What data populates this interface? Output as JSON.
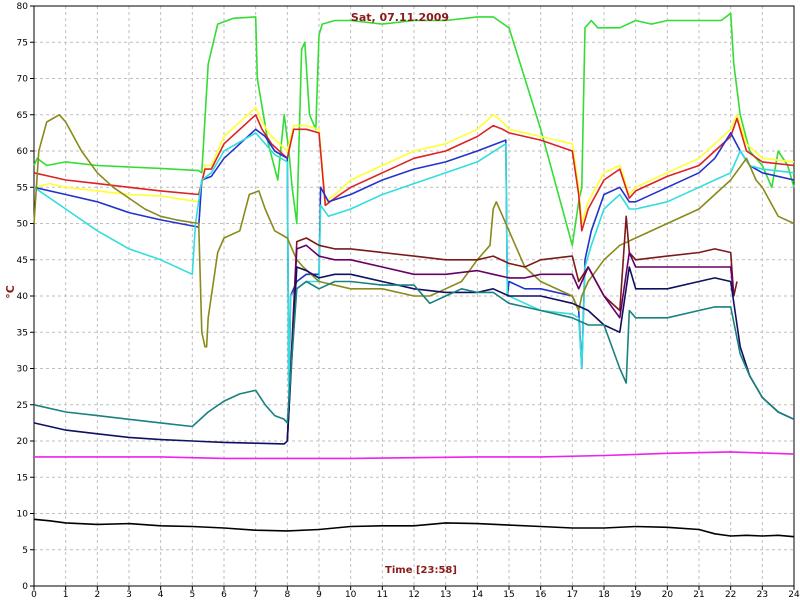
{
  "chart_data": {
    "type": "line",
    "title": "Sat, 07.11.2009",
    "xlabel": "Time [23:58]",
    "ylabel": "°C",
    "xlim": [
      0,
      24
    ],
    "ylim": [
      0,
      80
    ],
    "xticks": [
      0,
      1,
      2,
      3,
      4,
      5,
      6,
      7,
      8,
      9,
      10,
      11,
      12,
      13,
      14,
      15,
      16,
      17,
      18,
      19,
      20,
      21,
      22,
      23,
      24
    ],
    "yticks": [
      0,
      5,
      10,
      15,
      20,
      25,
      30,
      35,
      40,
      45,
      50,
      55,
      60,
      65,
      70,
      75,
      80
    ],
    "grid": true,
    "series": [
      {
        "color": "#33dd33",
        "x": [
          0,
          0.1,
          0.4,
          1,
          2,
          3,
          4,
          5.2,
          5.3,
          5.5,
          5.8,
          6.3,
          7,
          7.05,
          7.4,
          7.7,
          7.9,
          8.05,
          8.15,
          8.3,
          8.45,
          8.55,
          8.7,
          8.9,
          9.0,
          9.1,
          9.5,
          10,
          11,
          12,
          13,
          14,
          14.5,
          15,
          16,
          16.5,
          17,
          17.2,
          17.3,
          17.4,
          17.6,
          17.8,
          18.5,
          19,
          19.5,
          20,
          21,
          21.7,
          22.0,
          22.1,
          22.3,
          22.6,
          23,
          23.3,
          23.5,
          23.8,
          24
        ],
        "y": [
          58,
          59,
          58,
          58.5,
          58,
          57.8,
          57.6,
          57.3,
          57,
          72,
          77.5,
          78.3,
          78.5,
          70,
          61,
          56,
          65,
          60,
          55,
          50,
          74,
          75,
          65,
          63,
          76,
          77.5,
          78,
          78,
          77.5,
          78,
          78,
          78.5,
          78.5,
          77,
          63,
          55,
          47,
          53,
          55,
          77,
          78,
          77,
          77,
          78,
          77.5,
          78,
          78,
          78,
          79,
          72,
          65,
          60,
          58,
          55,
          60,
          58,
          55
        ]
      },
      {
        "color": "#ffff33",
        "x": [
          0,
          0.5,
          1,
          2,
          3,
          4,
          5.2,
          5.4,
          5.6,
          6,
          7,
          7.2,
          7.5,
          8,
          8.2,
          8.6,
          9,
          9.2,
          9.5,
          10,
          11,
          12,
          13,
          14,
          14.5,
          14.8,
          15,
          16,
          17,
          17.2,
          17.3,
          17.5,
          18,
          18.5,
          18.8,
          19,
          19.5,
          20,
          21,
          21.5,
          22,
          22.2,
          22.5,
          23,
          24
        ],
        "y": [
          55,
          55.5,
          55,
          54.5,
          54,
          53.8,
          53,
          58,
          58,
          62,
          66,
          64,
          62,
          60,
          63.5,
          63.5,
          63,
          53,
          54,
          56,
          58,
          60,
          61,
          63,
          65,
          64,
          63,
          62,
          61,
          55,
          50,
          53,
          57,
          58,
          54,
          55,
          56,
          57,
          59,
          61,
          63,
          65,
          61,
          59,
          58.5
        ]
      },
      {
        "color": "#dd2222",
        "x": [
          0,
          0.5,
          1,
          2,
          3,
          4,
          5.2,
          5.4,
          5.6,
          6,
          7,
          7.2,
          7.5,
          8,
          8.2,
          8.6,
          9,
          9.2,
          9.5,
          10,
          11,
          12,
          13,
          14,
          14.5,
          14.8,
          15,
          16,
          17,
          17.2,
          17.3,
          17.5,
          18,
          18.5,
          18.8,
          19,
          19.5,
          20,
          21,
          21.5,
          22,
          22.2,
          22.5,
          23,
          24
        ],
        "y": [
          57,
          56.5,
          56,
          55.5,
          55,
          54.5,
          54,
          57.5,
          57.5,
          61,
          65,
          63,
          61,
          59,
          63,
          63,
          62.5,
          52.5,
          53.5,
          55,
          57,
          59,
          60,
          62,
          63.5,
          63,
          62.5,
          61.5,
          60,
          54,
          49,
          52,
          56,
          57.5,
          53.5,
          54.5,
          55.5,
          56.5,
          58,
          60,
          62,
          64.5,
          60,
          58.5,
          58
        ]
      },
      {
        "color": "#2233cc",
        "x": [
          0,
          1,
          2,
          3,
          4,
          5.2,
          5.3,
          5.6,
          6,
          7,
          7.3,
          7.6,
          8,
          8.05,
          8.1,
          8.3,
          8.6,
          9,
          9.05,
          9.3,
          10,
          11,
          12,
          13,
          14,
          14.9,
          14.95,
          15,
          15.5,
          16,
          17,
          17.2,
          17.3,
          17.4,
          17.6,
          18,
          18.5,
          18.8,
          19,
          20,
          21,
          21.5,
          22,
          22.3,
          22.6,
          23,
          24
        ],
        "y": [
          55,
          54,
          53,
          51.5,
          50.5,
          49.5,
          56,
          56.5,
          59,
          63,
          62,
          60,
          59,
          25,
          40,
          42,
          43,
          43,
          55,
          53,
          54,
          56,
          57.5,
          58.5,
          60,
          61.5,
          40,
          42,
          41,
          41,
          40,
          38,
          30,
          45,
          49,
          54,
          55,
          53,
          53,
          55,
          57,
          59,
          62.5,
          60,
          58,
          57,
          56
        ]
      },
      {
        "color": "#33dddd",
        "x": [
          0,
          1,
          2,
          3,
          4,
          5.0,
          5.1,
          5.3,
          5.6,
          6,
          7,
          7.3,
          7.6,
          8,
          8.05,
          8.1,
          8.3,
          8.6,
          9,
          9.05,
          9.3,
          10,
          11,
          12,
          13,
          14,
          14.9,
          14.95,
          15,
          15.5,
          16,
          17,
          17.2,
          17.3,
          17.4,
          17.6,
          18,
          18.5,
          18.8,
          19,
          20,
          21,
          21.5,
          22,
          22.3,
          22.6,
          23,
          24
        ],
        "y": [
          55,
          52,
          49,
          46.5,
          45,
          43,
          50,
          56,
          57,
          60,
          62.5,
          61,
          59.5,
          58.5,
          25,
          40,
          41,
          42,
          42,
          52.5,
          51,
          52,
          54,
          55.5,
          57,
          58.5,
          61,
          40,
          40,
          39,
          38,
          37.5,
          37,
          30,
          44,
          47,
          52,
          54,
          52,
          52,
          53,
          55,
          56,
          57,
          60,
          58,
          57.5,
          57
        ]
      },
      {
        "color": "#8a8a1a",
        "x": [
          0,
          0.15,
          0.4,
          0.8,
          1.0,
          1.5,
          2,
          2.5,
          3,
          3.5,
          4,
          4.5,
          5.2,
          5.3,
          5.4,
          5.45,
          5.5,
          5.8,
          6.0,
          6.5,
          6.8,
          7.1,
          7.3,
          7.6,
          8,
          8.3,
          8.5,
          9,
          10,
          11,
          12,
          12.5,
          13,
          13.5,
          14,
          14.4,
          14.5,
          14.6,
          14.8,
          15.5,
          16,
          17,
          17.2,
          17.3,
          17.5,
          18,
          18.5,
          19,
          20,
          21,
          21.5,
          22,
          22.5,
          22.8,
          23,
          23.5,
          24
        ],
        "y": [
          50,
          60,
          64,
          65,
          64,
          60,
          57,
          55,
          53.5,
          52,
          51,
          50.5,
          50,
          35,
          33,
          33,
          37,
          46,
          48,
          49,
          54,
          54.5,
          52,
          49,
          48,
          45,
          44,
          42,
          41,
          41,
          40,
          40,
          41,
          42,
          45,
          47,
          52,
          53,
          51,
          44,
          42,
          40,
          38,
          40,
          42,
          45,
          47,
          48,
          50,
          52,
          54,
          56,
          59,
          56,
          55,
          51,
          50
        ]
      },
      {
        "color": "#6a0a4a",
        "x": [
          0.0
        ],
        "y": [
          null
        ]
      },
      {
        "color": "#7a1a1a",
        "x": [
          8.0,
          8.3,
          8.6,
          9,
          9.5,
          10,
          11,
          12,
          13,
          14,
          14.5,
          15,
          15.5,
          16,
          17,
          17.2,
          17.5,
          18,
          18.5,
          18.7,
          18.8,
          19,
          20,
          21,
          21.5,
          22,
          22.1,
          22.2
        ],
        "y": [
          20,
          47.5,
          48,
          47,
          46.5,
          46.5,
          46,
          45.5,
          45,
          45,
          45.5,
          44.5,
          44,
          45,
          45.5,
          42,
          44,
          40,
          38,
          51,
          46,
          45,
          45.5,
          46,
          46.5,
          46,
          40,
          42
        ]
      },
      {
        "color": "#660066",
        "x": [
          8.0,
          8.3,
          8.6,
          9,
          9.5,
          10,
          11,
          12,
          13,
          14,
          14.5,
          15,
          15.5,
          16,
          17,
          17.2,
          17.5,
          18,
          18.5,
          18.8,
          19,
          20,
          21,
          21.5,
          22,
          22.1
        ],
        "y": [
          20,
          46.5,
          47,
          45.5,
          45,
          45,
          44,
          43,
          43,
          43.5,
          43,
          42.5,
          42.5,
          43,
          43,
          41,
          44,
          40,
          37,
          46,
          44,
          44,
          44,
          44,
          44,
          40
        ]
      },
      {
        "color": "#101060",
        "x": [
          0,
          1,
          2,
          3,
          4,
          5,
          6,
          7,
          7.9,
          8.0,
          8.3,
          8.6,
          9,
          9.5,
          10,
          11,
          12,
          13,
          14,
          14.5,
          15,
          15.5,
          16,
          17,
          17.5,
          18,
          18.5,
          18.8,
          19,
          20,
          21,
          21.5,
          22,
          22.3,
          22.6,
          23,
          23.5,
          24
        ],
        "y": [
          22.5,
          21.5,
          21,
          20.5,
          20.2,
          20,
          19.8,
          19.7,
          19.6,
          20,
          44,
          43.5,
          42.5,
          43,
          43,
          42,
          41,
          40.5,
          40.5,
          41,
          40,
          40,
          40,
          39,
          38,
          36,
          35,
          44,
          41,
          41,
          42,
          42.5,
          42,
          33,
          29,
          26,
          24,
          23
        ]
      },
      {
        "color": "#1a8080",
        "x": [
          0,
          1,
          2,
          3,
          4,
          5,
          5.5,
          6,
          6.5,
          7.0,
          7.3,
          7.6,
          7.9,
          8.0,
          8.3,
          8.6,
          9,
          9.5,
          10,
          11,
          12,
          12.5,
          13,
          13.5,
          14,
          14.5,
          15,
          15.5,
          16,
          17,
          17.5,
          18,
          18.5,
          18.7,
          18.8,
          19,
          20,
          21,
          21.5,
          22,
          22.3,
          22.6,
          23,
          23.5,
          24
        ],
        "y": [
          25,
          24,
          23.5,
          23,
          22.5,
          22,
          24,
          25.5,
          26.5,
          27,
          25,
          23.5,
          23,
          22.5,
          41,
          42,
          41,
          42,
          42,
          41.5,
          41.5,
          39,
          40,
          41,
          40.5,
          40.5,
          39,
          38.5,
          38,
          37,
          36,
          36,
          30,
          28,
          38,
          37,
          37,
          38,
          38.5,
          38.5,
          32,
          29,
          26,
          24,
          23
        ]
      },
      {
        "color": "#ee22ee",
        "x": [
          0,
          2,
          4,
          6,
          8,
          10,
          12,
          14,
          16,
          18,
          20,
          22,
          24
        ],
        "y": [
          17.8,
          17.8,
          17.8,
          17.6,
          17.6,
          17.6,
          17.7,
          17.8,
          17.8,
          18,
          18.3,
          18.5,
          18.2
        ]
      },
      {
        "color": "#000000",
        "x": [
          0,
          0.5,
          1,
          2,
          3,
          4,
          5,
          6,
          7,
          8,
          9,
          10,
          11,
          12,
          13,
          14,
          15,
          16,
          17,
          18,
          19,
          20,
          21,
          21.5,
          22,
          22.5,
          23,
          23.5,
          24
        ],
        "y": [
          9.2,
          9.0,
          8.7,
          8.5,
          8.6,
          8.3,
          8.2,
          8.0,
          7.7,
          7.6,
          7.8,
          8.2,
          8.3,
          8.3,
          8.7,
          8.6,
          8.4,
          8.2,
          8.0,
          8.0,
          8.2,
          8.1,
          7.8,
          7.2,
          6.9,
          7.0,
          6.9,
          7.0,
          6.8
        ]
      }
    ]
  }
}
